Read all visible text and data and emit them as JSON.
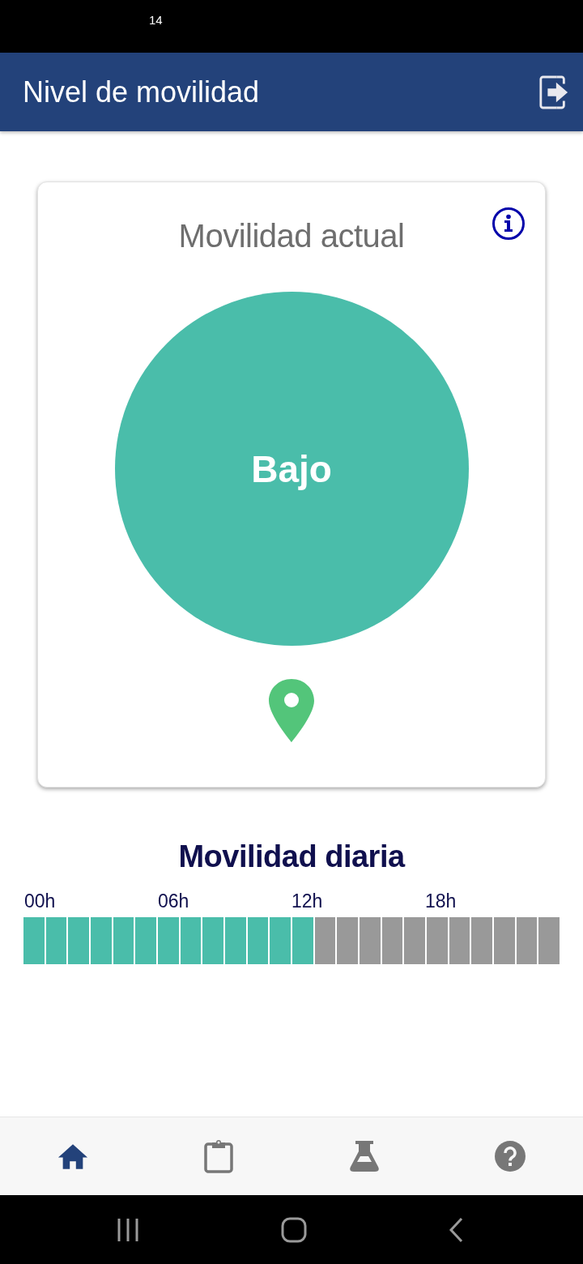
{
  "status_bar": {
    "time": "14"
  },
  "header": {
    "title": "Nivel de movilidad"
  },
  "current": {
    "title": "Movilidad actual",
    "level_text": "Bajo"
  },
  "daily": {
    "title": "Movilidad diaria",
    "tick_labels": [
      "00h",
      "06h",
      "12h",
      "18h"
    ],
    "segments": [
      {
        "active": true
      },
      {
        "active": true
      },
      {
        "active": true
      },
      {
        "active": true
      },
      {
        "active": true
      },
      {
        "active": true
      },
      {
        "active": true
      },
      {
        "active": true
      },
      {
        "active": true
      },
      {
        "active": true
      },
      {
        "active": true
      },
      {
        "active": true
      },
      {
        "active": true
      },
      {
        "active": false
      },
      {
        "active": false
      },
      {
        "active": false
      },
      {
        "active": false
      },
      {
        "active": false
      },
      {
        "active": false
      },
      {
        "active": false
      },
      {
        "active": false
      },
      {
        "active": false
      },
      {
        "active": false
      },
      {
        "active": false
      }
    ]
  },
  "bottom_nav": [
    {
      "kind": "home",
      "selected": true
    },
    {
      "kind": "clipboard",
      "selected": false
    },
    {
      "kind": "flask",
      "selected": false
    },
    {
      "kind": "help",
      "selected": false
    }
  ]
}
